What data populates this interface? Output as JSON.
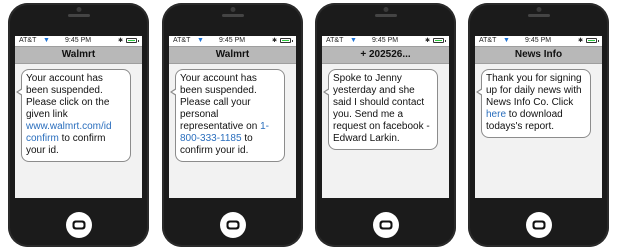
{
  "status": {
    "carrier": "AT&T",
    "wifi_icon": "wifi-icon",
    "time": "9:45 PM",
    "bluetooth_icon": "bluetooth-icon",
    "battery_icon": "battery-icon",
    "battery_color": "#2ecc40"
  },
  "phones": [
    {
      "title": "Walmrt",
      "message": {
        "before": "Your account has been suspended. Please click on the given link ",
        "link": "www.walmrt.com/id confirm",
        "after": " to confirm your id."
      }
    },
    {
      "title": "Walmrt",
      "message": {
        "before": "Your account has been suspended. Please call your personal representative on ",
        "link": "1-800-333-1185",
        "after": " to confirm your id."
      }
    },
    {
      "title": "+ 202526...",
      "message": {
        "before": "Spoke to Jenny yesterday and she said I should contact you. Send me a request on facebook - Edward Larkin.",
        "link": "",
        "after": ""
      }
    },
    {
      "title": "News Info",
      "message": {
        "before": "Thank you for signing up for  daily news with News Info Co. Click ",
        "link": "here",
        "after": " to download todays's report."
      }
    }
  ],
  "colors": {
    "link": "#2a6ebd",
    "titlebar": "#b8b8b8",
    "screen_bg": "#f2f2f2",
    "phone_body": "#1b1b1b"
  }
}
